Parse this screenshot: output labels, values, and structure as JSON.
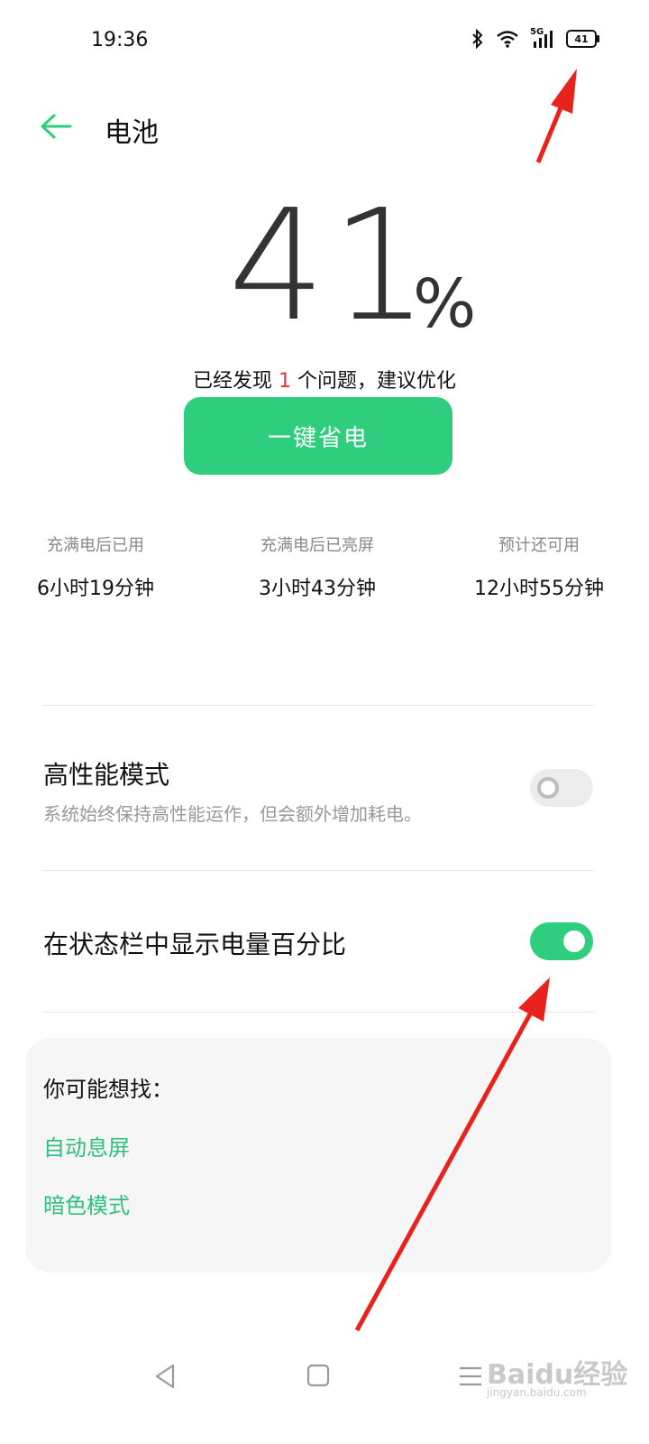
{
  "status_bar": {
    "time": "19:36",
    "network": "5G",
    "battery_level": "41"
  },
  "header": {
    "title": "电池"
  },
  "battery": {
    "percent": "41",
    "percent_sign": "%"
  },
  "issue": {
    "prefix": "已经发现 ",
    "count": "1",
    "suffix": " 个问题，建议优化"
  },
  "optimize_button": {
    "label": "一键省电"
  },
  "stats": [
    {
      "label": "充满电后已用",
      "value": "6小时19分钟"
    },
    {
      "label": "充满电后已亮屏",
      "value": "3小时43分钟"
    },
    {
      "label": "预计还可用",
      "value": "12小时55分钟"
    }
  ],
  "settings": {
    "high_performance": {
      "title": "高性能模式",
      "desc": "系统始终保持高性能运作，但会额外增加耗电。",
      "enabled": false
    },
    "show_percentage": {
      "title": "在状态栏中显示电量百分比",
      "enabled": true
    }
  },
  "suggestions": {
    "title": "你可能想找：",
    "links": [
      "自动息屏",
      "暗色模式"
    ]
  },
  "watermark": {
    "brand": "Baidu经验",
    "url": "jingyan.baidu.com"
  },
  "colors": {
    "accent": "#2fce7f",
    "annotation_arrow": "#e8231e",
    "issue_count": "#e53935"
  }
}
